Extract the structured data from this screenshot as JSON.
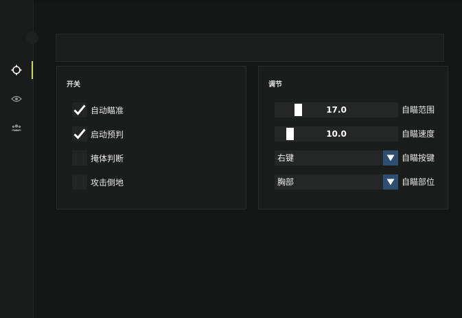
{
  "sidebar": {
    "items": [
      {
        "icon": "crosshair-icon",
        "active": true
      },
      {
        "icon": "eye-icon",
        "active": false
      },
      {
        "icon": "users-icon",
        "active": false
      }
    ],
    "accent_color": "#c8d96a"
  },
  "switches": {
    "title": "开关",
    "items": [
      {
        "label": "自动瞄准",
        "checked": true
      },
      {
        "label": "启动预判",
        "checked": true
      },
      {
        "label": "掩体判断",
        "checked": false
      },
      {
        "label": "攻击倒地",
        "checked": false
      }
    ]
  },
  "adjust": {
    "title": "调节",
    "aim_range": {
      "value": "17.0",
      "label": "自瞄范围",
      "level": 0.17
    },
    "aim_speed": {
      "value": "10.0",
      "label": "自瞄速度",
      "level": 0.1
    },
    "aim_key": {
      "value": "右键",
      "label": "自瞄按键"
    },
    "aim_part": {
      "value": "胸部",
      "label": "自瞄部位"
    },
    "dropdown_color": "#2f4f72"
  }
}
